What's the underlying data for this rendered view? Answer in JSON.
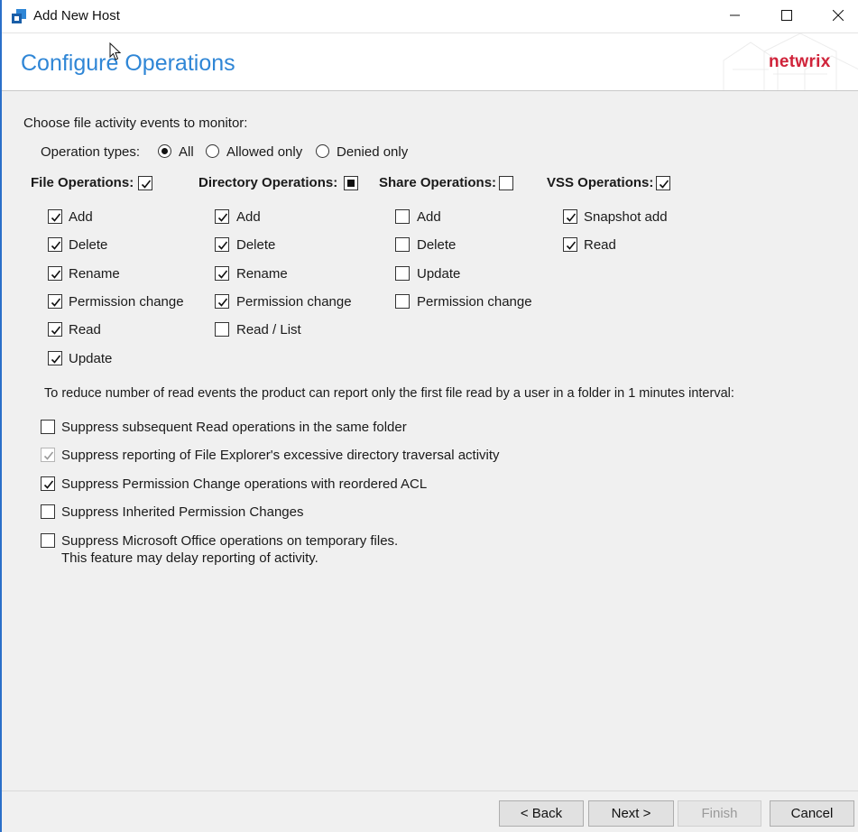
{
  "window": {
    "title": "Add New Host",
    "accent_color": "#2a6fc9"
  },
  "header": {
    "title": "Configure Operations",
    "logo_text": "netwrix",
    "title_color": "#2f86d6",
    "logo_color": "#d0233a"
  },
  "main": {
    "prompt": "Choose file activity events to monitor:",
    "operation_types": {
      "label": "Operation types:",
      "options": [
        {
          "label": "All",
          "selected": true
        },
        {
          "label": "Allowed only",
          "selected": false
        },
        {
          "label": "Denied only",
          "selected": false
        }
      ]
    },
    "groups": {
      "file": {
        "label": "File Operations:",
        "state": "checked",
        "items": [
          {
            "label": "Add",
            "checked": true
          },
          {
            "label": "Delete",
            "checked": true
          },
          {
            "label": "Rename",
            "checked": true
          },
          {
            "label": "Permission change",
            "checked": true
          },
          {
            "label": "Read",
            "checked": true
          },
          {
            "label": "Update",
            "checked": true
          }
        ]
      },
      "directory": {
        "label": "Directory Operations:",
        "state": "indeterminate",
        "items": [
          {
            "label": "Add",
            "checked": true
          },
          {
            "label": "Delete",
            "checked": true
          },
          {
            "label": "Rename",
            "checked": true
          },
          {
            "label": "Permission change",
            "checked": true
          },
          {
            "label": "Read / List",
            "checked": false
          }
        ]
      },
      "share": {
        "label": "Share Operations:",
        "state": "unchecked",
        "items": [
          {
            "label": "Add",
            "checked": false
          },
          {
            "label": "Delete",
            "checked": false
          },
          {
            "label": "Update",
            "checked": false
          },
          {
            "label": "Permission change",
            "checked": false
          }
        ]
      },
      "vss": {
        "label": "VSS Operations:",
        "state": "checked",
        "items": [
          {
            "label": "Snapshot add",
            "checked": true
          },
          {
            "label": "Read",
            "checked": true
          }
        ]
      }
    },
    "note": "To reduce number of read events the product can report only the first file read by a user in a folder in 1 minutes interval:",
    "suppress_options": [
      {
        "label": "Suppress subsequent Read operations in the same folder",
        "checked": false,
        "disabled": false
      },
      {
        "label": "Suppress reporting of File Explorer's excessive directory traversal activity",
        "checked": true,
        "disabled": true
      },
      {
        "label": "Suppress Permission Change operations with reordered ACL",
        "checked": true,
        "disabled": false
      },
      {
        "label": "Suppress Inherited Permission Changes",
        "checked": false,
        "disabled": false
      },
      {
        "label": "Suppress Microsoft Office operations on temporary files.",
        "sub_label": "This feature may delay reporting of activity.",
        "checked": false,
        "disabled": false
      }
    ]
  },
  "footer": {
    "back_label": "< Back",
    "next_label": "Next >",
    "finish_label": "Finish",
    "cancel_label": "Cancel"
  }
}
